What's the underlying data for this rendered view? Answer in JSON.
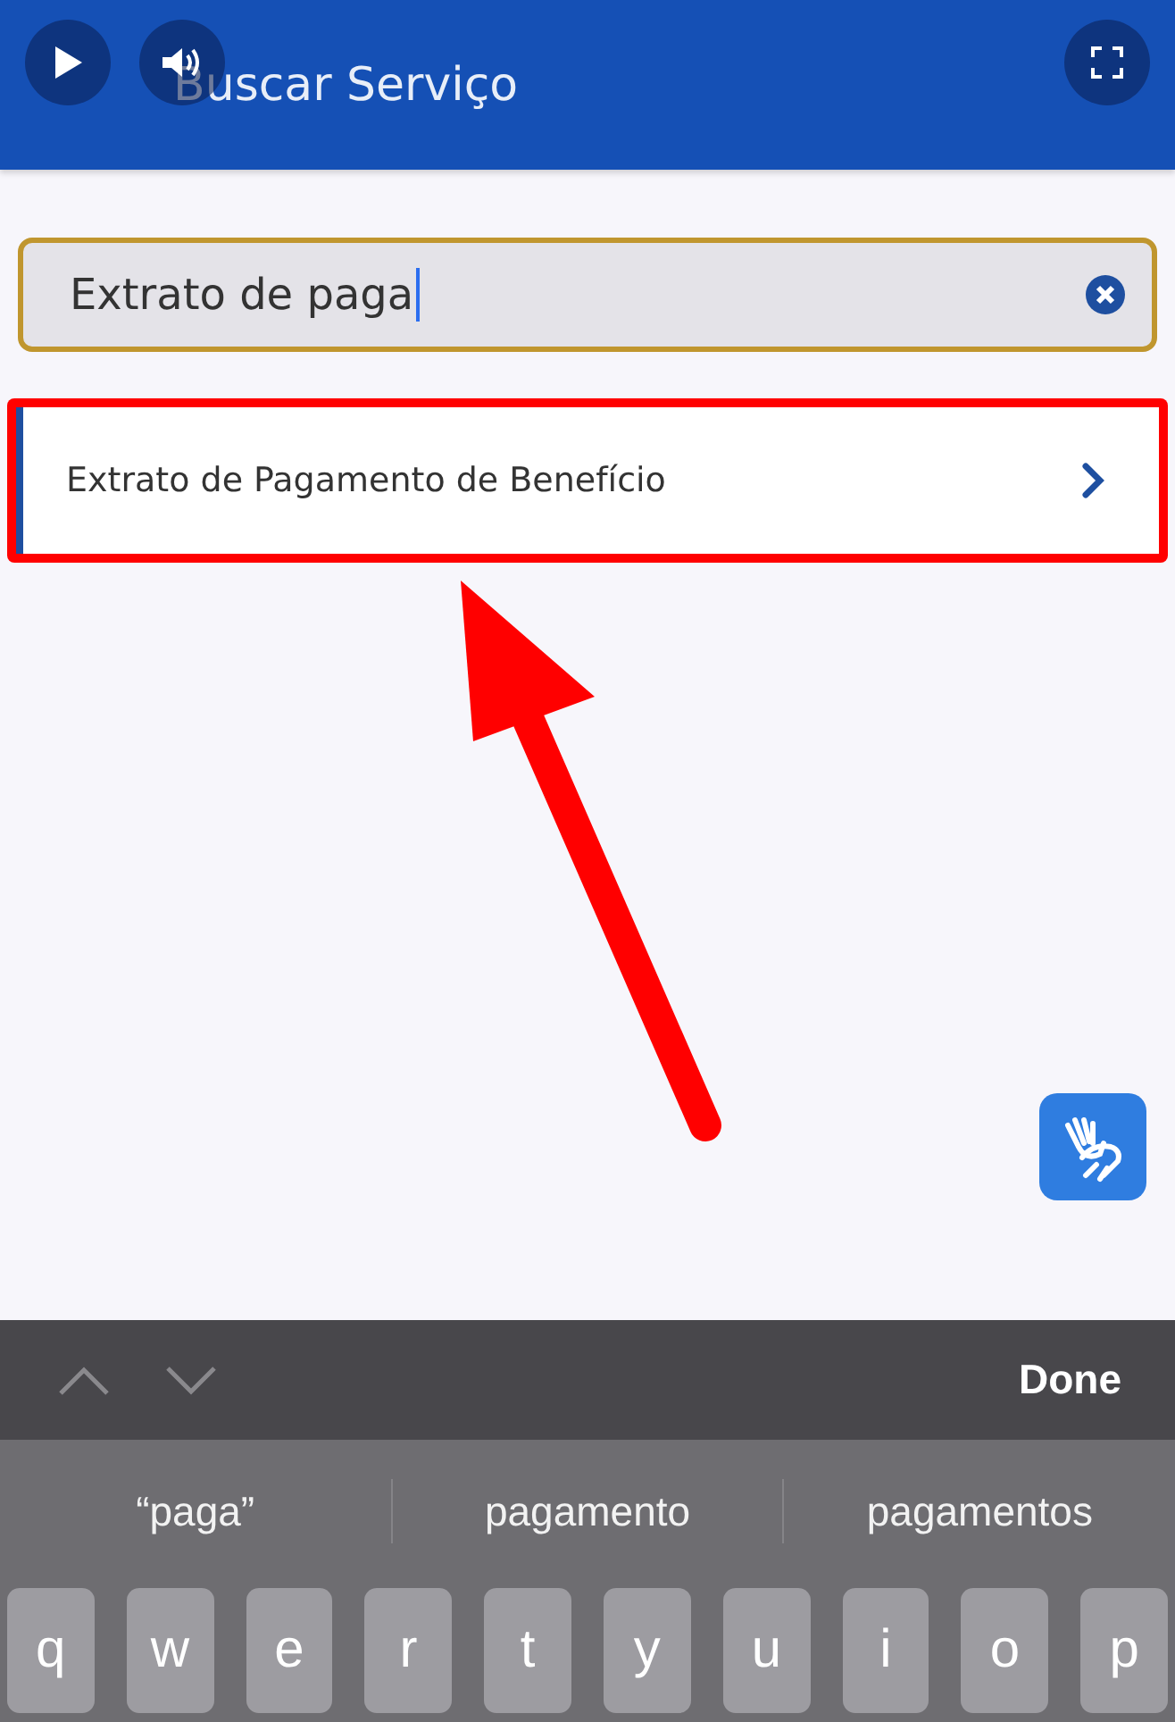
{
  "header": {
    "title": "Buscar Serviço"
  },
  "search": {
    "value": "Extrato de paga"
  },
  "results": [
    {
      "label": "Extrato de Pagamento de Benefício",
      "highlighted": true
    }
  ],
  "keyboard": {
    "done": "Done",
    "suggestions": [
      "“paga”",
      "pagamento",
      "pagamentos"
    ],
    "keys": [
      "q",
      "w",
      "e",
      "r",
      "t",
      "y",
      "u",
      "i",
      "o",
      "p"
    ]
  }
}
